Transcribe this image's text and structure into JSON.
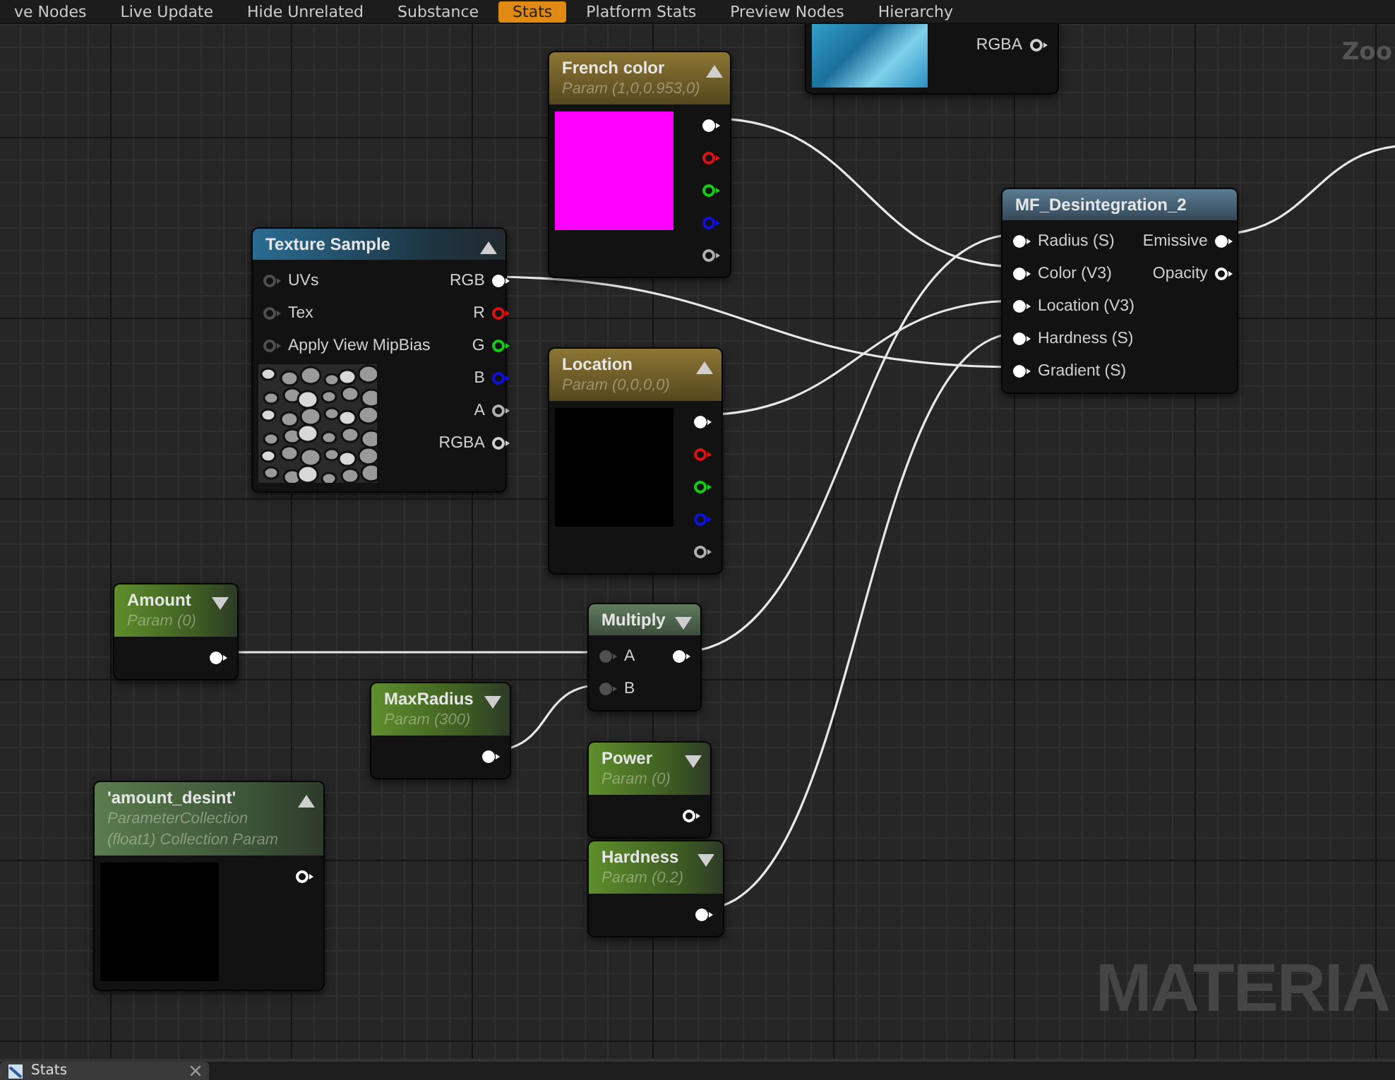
{
  "toolbar": [
    {
      "label": "ve Nodes",
      "selected": false
    },
    {
      "label": "Live Update",
      "selected": false
    },
    {
      "label": "Hide Unrelated",
      "selected": false
    },
    {
      "label": "Substance",
      "selected": false
    },
    {
      "label": "Stats",
      "selected": true
    },
    {
      "label": "Platform Stats",
      "selected": false
    },
    {
      "label": "Preview Nodes",
      "selected": false
    },
    {
      "label": "Hierarchy",
      "selected": false
    }
  ],
  "canvas": {
    "zoom_label": "Zoo",
    "watermark": "MATERIA"
  },
  "nodes": [
    {
      "kind": "clipped",
      "preview": {
        "kind": "photo"
      },
      "outputs": [
        {
          "label": "RGBA",
          "connected": false,
          "color": "#d0d0d0"
        }
      ]
    },
    {
      "kind": "vector_param",
      "title": "French color",
      "subtitles": [
        "Param (1,0,0.953,0)"
      ],
      "expanded": true,
      "preview": {
        "kind": "swatch",
        "color": "#ff00ff"
      },
      "outputs": [
        {
          "connected": true,
          "color": "#ffffff"
        },
        {
          "connected": false,
          "color": "#e01010"
        },
        {
          "connected": false,
          "color": "#10d010"
        },
        {
          "connected": false,
          "color": "#1010e0"
        },
        {
          "connected": false,
          "color": "#b0b0b0"
        }
      ]
    },
    {
      "kind": "texture_sample",
      "title": "Texture Sample",
      "expanded": true,
      "preview": {
        "kind": "noise"
      },
      "inputs": [
        {
          "label": "UVs",
          "connected": false,
          "color": "#505050"
        },
        {
          "label": "Tex",
          "connected": false,
          "color": "#505050"
        },
        {
          "label": "Apply View MipBias",
          "connected": false,
          "color": "#505050"
        }
      ],
      "outputs": [
        {
          "label": "RGB",
          "connected": true,
          "color": "#ffffff"
        },
        {
          "label": "R",
          "connected": false,
          "color": "#e01010"
        },
        {
          "label": "G",
          "connected": false,
          "color": "#10d010"
        },
        {
          "label": "B",
          "connected": false,
          "color": "#1010e0"
        },
        {
          "label": "A",
          "connected": false,
          "color": "#b0b0b0"
        },
        {
          "label": "RGBA",
          "connected": false,
          "color": "#d0d0d0"
        }
      ]
    },
    {
      "kind": "vector_param",
      "title": "Location",
      "subtitles": [
        "Param (0,0,0,0)"
      ],
      "expanded": true,
      "preview": {
        "kind": "swatch",
        "color": "#000000"
      },
      "outputs": [
        {
          "connected": true,
          "color": "#ffffff"
        },
        {
          "connected": false,
          "color": "#e01010"
        },
        {
          "connected": false,
          "color": "#10d010"
        },
        {
          "connected": false,
          "color": "#1010e0"
        },
        {
          "connected": false,
          "color": "#b0b0b0"
        }
      ]
    },
    {
      "kind": "function",
      "title": "MF_Desintegration_2",
      "inputs": [
        {
          "label": "Radius (S)",
          "connected": true,
          "color": "#ffffff"
        },
        {
          "label": "Color (V3)",
          "connected": true,
          "color": "#ffffff"
        },
        {
          "label": "Location (V3)",
          "connected": true,
          "color": "#ffffff"
        },
        {
          "label": "Hardness (S)",
          "connected": true,
          "color": "#ffffff"
        },
        {
          "label": "Gradient (S)",
          "connected": true,
          "color": "#ffffff"
        }
      ],
      "outputs": [
        {
          "label": "Emissive",
          "connected": true,
          "color": "#ffffff"
        },
        {
          "label": "Opacity",
          "connected": false,
          "color": "#ffffff"
        }
      ]
    },
    {
      "kind": "scalar_param",
      "title": "Amount",
      "subtitles": [
        "Param (0)"
      ],
      "expanded": false,
      "outputs": [
        {
          "connected": true,
          "color": "#ffffff"
        }
      ]
    },
    {
      "kind": "math",
      "title": "Multiply",
      "expanded": false,
      "inputs": [
        {
          "label": "A",
          "connected": true,
          "color": "#505050"
        },
        {
          "label": "B",
          "connected": true,
          "color": "#505050"
        }
      ],
      "outputs": [
        {
          "connected": true,
          "color": "#ffffff"
        }
      ]
    },
    {
      "kind": "scalar_param",
      "title": "MaxRadius",
      "subtitles": [
        "Param (300)"
      ],
      "expanded": false,
      "outputs": [
        {
          "connected": true,
          "color": "#ffffff"
        }
      ]
    },
    {
      "kind": "collection_param",
      "title": "'amount_desint'",
      "subtitles": [
        "ParameterCollection",
        "(float1) Collection Param"
      ],
      "expanded": true,
      "preview": {
        "kind": "swatch",
        "color": "#000000"
      },
      "outputs": [
        {
          "connected": false,
          "color": "#ffffff"
        }
      ]
    },
    {
      "kind": "scalar_param",
      "title": "Power",
      "subtitles": [
        "Param (0)"
      ],
      "expanded": false,
      "outputs": [
        {
          "connected": false,
          "color": "#ffffff"
        }
      ]
    },
    {
      "kind": "scalar_param",
      "title": "Hardness",
      "subtitles": [
        "Param (0.2)"
      ],
      "expanded": false,
      "outputs": [
        {
          "connected": true,
          "color": "#ffffff"
        }
      ]
    }
  ],
  "bottom_tabs": [
    {
      "label": "Stats",
      "selected": true
    }
  ]
}
